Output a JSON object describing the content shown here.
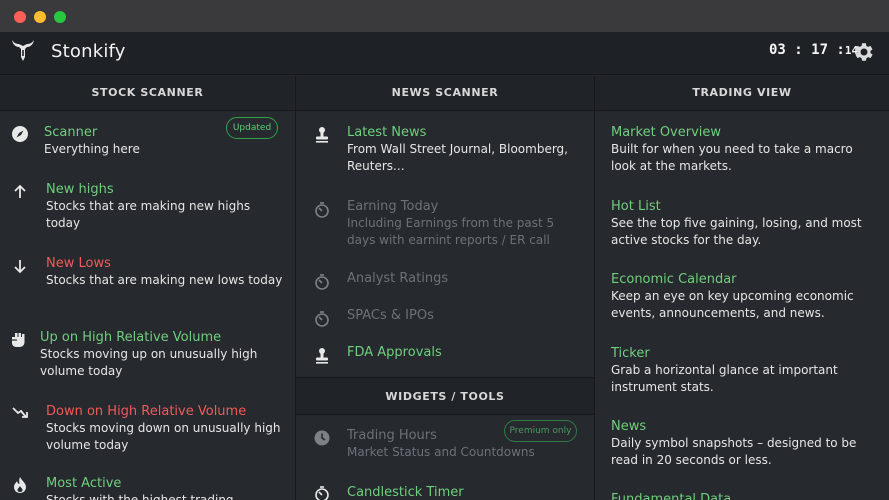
{
  "app": {
    "title": "Stonkify"
  },
  "clock": {
    "hm": "03 : 17 :",
    "sec": "14"
  },
  "stock_scanner": {
    "heading": "STOCK SCANNER",
    "badge": "Updated",
    "items": [
      {
        "title": "Scanner",
        "desc": "Everything here"
      },
      {
        "title": "New highs",
        "desc": "Stocks that are making new highs today"
      },
      {
        "title": "New Lows",
        "desc": "Stocks that are making new lows today"
      },
      {
        "title": "Up on High Relative Volume",
        "desc": "Stocks moving up on unusually high volume today"
      },
      {
        "title": "Down on High Relative Volume",
        "desc": "Stocks moving down on unusually high volume today"
      },
      {
        "title": "Most Active",
        "desc": "Stocks with the highest trading"
      }
    ]
  },
  "news_scanner": {
    "heading": "NEWS SCANNER",
    "items": [
      {
        "title": "Latest News",
        "desc": "From Wall Street Journal, Bloomberg, Reuters..."
      },
      {
        "title": "Earning Today",
        "desc": "Including Earnings from the past 5 days with earnint reports / ER call"
      },
      {
        "title": "Analyst Ratings"
      },
      {
        "title": "SPACs & IPOs"
      },
      {
        "title": "FDA Approvals"
      }
    ]
  },
  "widgets_tools": {
    "heading": "WIDGETS / TOOLS",
    "badge": "Premium only",
    "items": [
      {
        "title": "Trading Hours",
        "desc": "Market Status and Countdowns"
      },
      {
        "title": "Candlestick Timer"
      }
    ]
  },
  "trading_view": {
    "heading": "TRADING VIEW",
    "items": [
      {
        "title": "Market Overview",
        "desc": "Built for when you need to take a macro look at the markets."
      },
      {
        "title": "Hot List",
        "desc": "See the top five gaining, losing, and most active stocks for the day."
      },
      {
        "title": "Economic Calendar",
        "desc": "Keep an eye on key upcoming economic events, announcements, and news."
      },
      {
        "title": "Ticker",
        "desc": "Grab a horizontal glance at important instrument stats."
      },
      {
        "title": "News",
        "desc": "Daily symbol snapshots – designed to be read in 20 seconds or less."
      },
      {
        "title": "Fundamental Data"
      }
    ]
  },
  "colors": {
    "accent_green": "#6fcf7c",
    "accent_red": "#f05a5a",
    "dim_text": "#6d7177",
    "background": "#26292e"
  },
  "icons": [
    "bull-logo-icon",
    "gear-icon",
    "compass-icon",
    "arrow-up-icon",
    "arrow-down-icon",
    "fist-icon",
    "trend-down-icon",
    "flame-icon",
    "stamp-icon",
    "timer-icon",
    "clock-icon"
  ]
}
